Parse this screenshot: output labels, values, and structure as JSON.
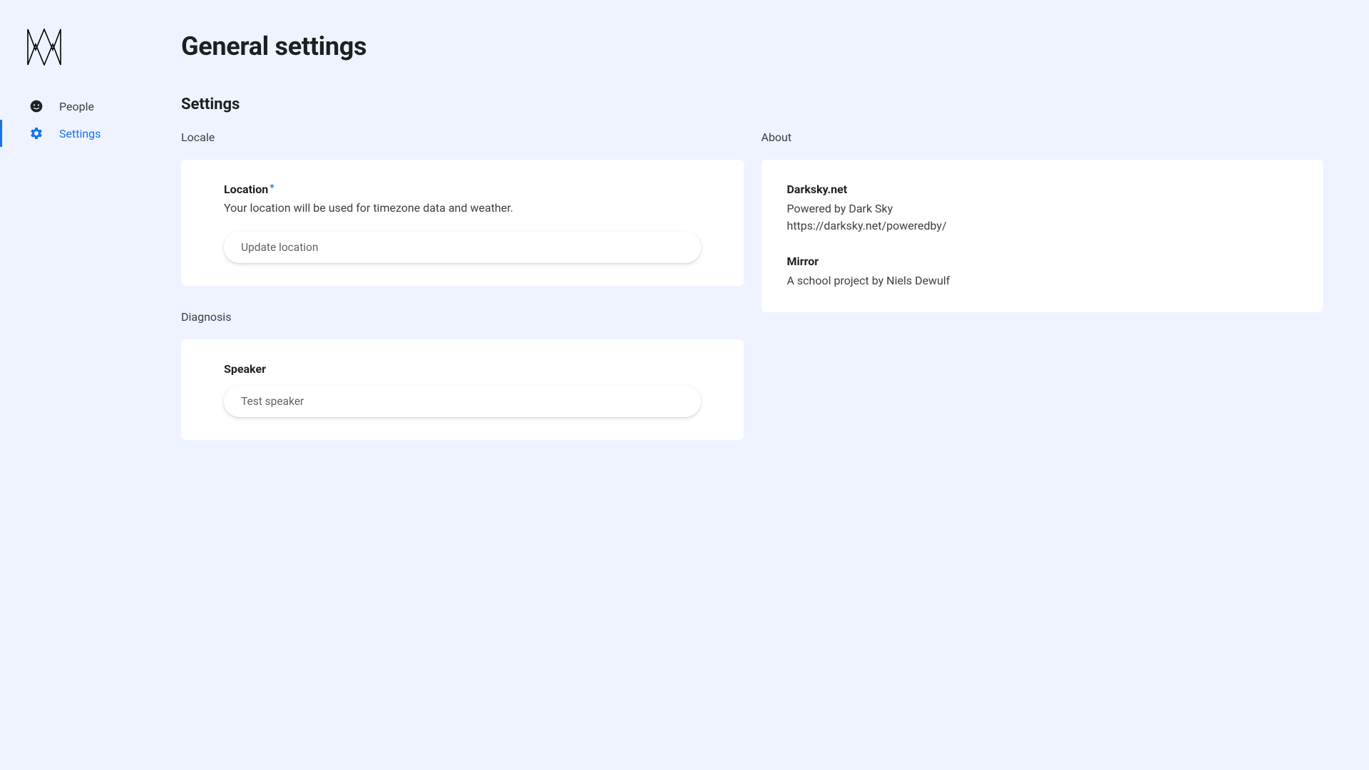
{
  "sidebar": {
    "items": [
      {
        "label": "People"
      },
      {
        "label": "Settings"
      }
    ]
  },
  "page": {
    "title": "General settings",
    "section_title": "Settings"
  },
  "locale": {
    "group_label": "Locale",
    "location_title": "Location",
    "location_desc": "Your location will be used for timezone data and weather.",
    "update_button": "Update location"
  },
  "diagnosis": {
    "group_label": "Diagnosis",
    "speaker_title": "Speaker",
    "test_button": "Test speaker"
  },
  "about": {
    "group_label": "About",
    "darksky_title": "Darksky.net",
    "darksky_line1": "Powered by Dark Sky",
    "darksky_line2": "https://darksky.net/poweredby/",
    "mirror_title": "Mirror",
    "mirror_line1": "A school project by Niels Dewulf"
  }
}
